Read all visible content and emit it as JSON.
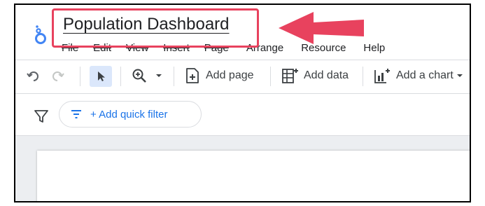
{
  "header": {
    "title": "Population Dashboard",
    "menu": [
      "File",
      "Edit",
      "View",
      "Insert",
      "Page",
      "Arrange",
      "Resource",
      "Help"
    ]
  },
  "toolbar": {
    "add_page": "Add page",
    "add_data": "Add data",
    "add_chart": "Add a chart"
  },
  "filter_bar": {
    "quick_filter": "+ Add quick filter"
  },
  "colors": {
    "accent": "#1a73e8",
    "highlight": "#e8425e",
    "select_bg": "#dbe7fb"
  },
  "icons": [
    "looker-studio-logo",
    "undo-icon",
    "redo-icon",
    "select-pointer-icon",
    "zoom-icon",
    "chevron-down-icon",
    "add-page-icon",
    "add-data-icon",
    "add-chart-icon",
    "filter-icon",
    "filter-list-icon",
    "annotation-arrow-icon"
  ]
}
